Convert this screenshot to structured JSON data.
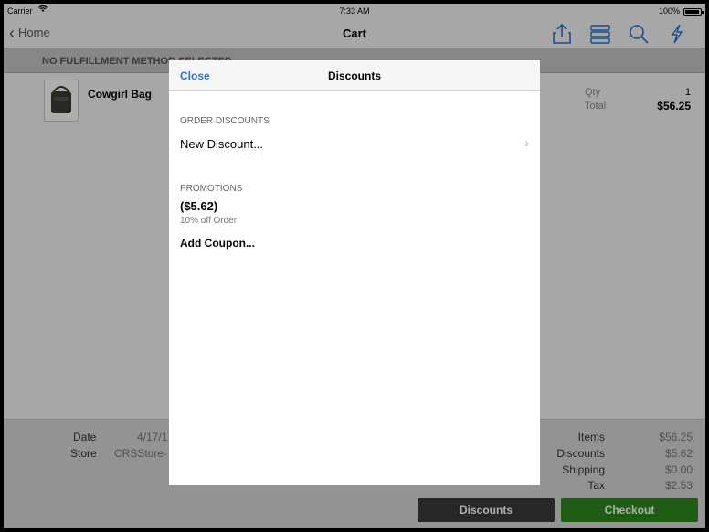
{
  "status_bar": {
    "carrier": "Carrier",
    "time": "7:33 AM",
    "battery": "100%"
  },
  "nav": {
    "back_label": "Home",
    "title": "Cart",
    "icons": [
      "share-icon",
      "list-icon",
      "search-icon",
      "lightning-icon"
    ]
  },
  "fulfillment": {
    "text": "NO FULFILLMENT METHOD SELECTED"
  },
  "cart_item": {
    "name": "Cowgirl Bag",
    "qty_label": "Qty",
    "qty": "1",
    "total_label": "Total",
    "total": "$56.25"
  },
  "summary": {
    "date_label": "Date",
    "date_value": "4/17/1",
    "store_label": "Store",
    "store_value": "CRSStore-",
    "items_label": "Items",
    "items_value": "$56.25",
    "discounts_label": "Discounts",
    "discounts_value": "$5.62",
    "shipping_label": "Shipping",
    "shipping_value": "$0.00",
    "tax_label": "Tax",
    "tax_value": "$2.53"
  },
  "buttons": {
    "discounts": "Discounts",
    "checkout": "Checkout"
  },
  "modal": {
    "close_label": "Close",
    "title": "Discounts",
    "order_discounts_header": "ORDER DISCOUNTS",
    "new_discount": "New Discount...",
    "promotions_header": "PROMOTIONS",
    "promo_amount": "($5.62)",
    "promo_description": "10% off Order",
    "add_coupon": "Add Coupon..."
  },
  "colors": {
    "accent": "#2a74d6",
    "checkout_green": "#2f8a1f",
    "dark_button": "#3a3a3a"
  }
}
